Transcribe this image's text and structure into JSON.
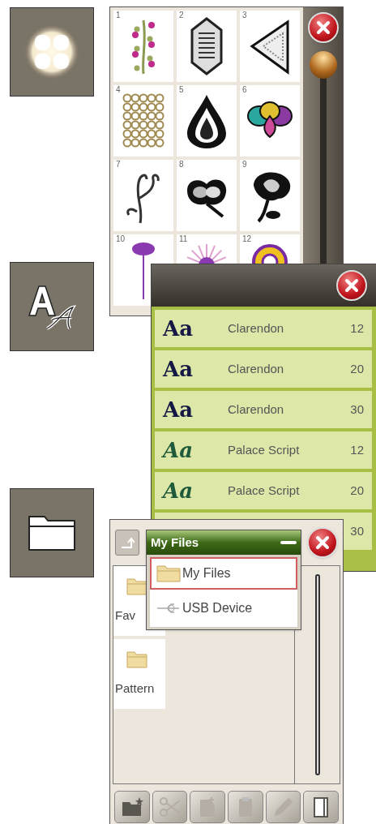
{
  "side_buttons": [
    {
      "kind": "design"
    },
    {
      "kind": "font"
    },
    {
      "kind": "folder"
    }
  ],
  "design_menu": {
    "designs": [
      {
        "number": "1",
        "kind": "vine"
      },
      {
        "number": "2",
        "kind": "hexagon"
      },
      {
        "number": "3",
        "kind": "triangle"
      },
      {
        "number": "4",
        "kind": "lattice"
      },
      {
        "number": "5",
        "kind": "teardrop"
      },
      {
        "number": "6",
        "kind": "petals"
      },
      {
        "number": "7",
        "kind": "swirl"
      },
      {
        "number": "8",
        "kind": "bloom"
      },
      {
        "number": "9",
        "kind": "tulip"
      },
      {
        "number": "10",
        "kind": "stem"
      },
      {
        "number": "11",
        "kind": "burst"
      },
      {
        "number": "12",
        "kind": "ring"
      }
    ]
  },
  "font_menu": {
    "fonts": [
      {
        "sample": "Aa",
        "kind": "serif",
        "name": "Clarendon",
        "size": "12"
      },
      {
        "sample": "Aa",
        "kind": "serif",
        "name": "Clarendon",
        "size": "20"
      },
      {
        "sample": "Aa",
        "kind": "serif",
        "name": "Clarendon",
        "size": "30"
      },
      {
        "sample": "Aa",
        "kind": "script",
        "name": "Palace Script",
        "size": "12"
      },
      {
        "sample": "Aa",
        "kind": "script",
        "name": "Palace Script",
        "size": "20"
      },
      {
        "size": "30"
      }
    ]
  },
  "file_manager": {
    "title": "My Files",
    "items": [
      {
        "label": "Fav"
      },
      {
        "label": "Pattern"
      }
    ],
    "locations": [
      {
        "label": "My Files",
        "kind": "folder",
        "selected": true
      },
      {
        "label": "USB Device",
        "kind": "usb",
        "selected": false
      }
    ],
    "toolbar": [
      {
        "kind": "newfolder",
        "disabled": false
      },
      {
        "kind": "cut",
        "disabled": true
      },
      {
        "kind": "copy",
        "disabled": true
      },
      {
        "kind": "paste",
        "disabled": true
      },
      {
        "kind": "rename",
        "disabled": true
      },
      {
        "kind": "view",
        "disabled": false
      }
    ]
  }
}
